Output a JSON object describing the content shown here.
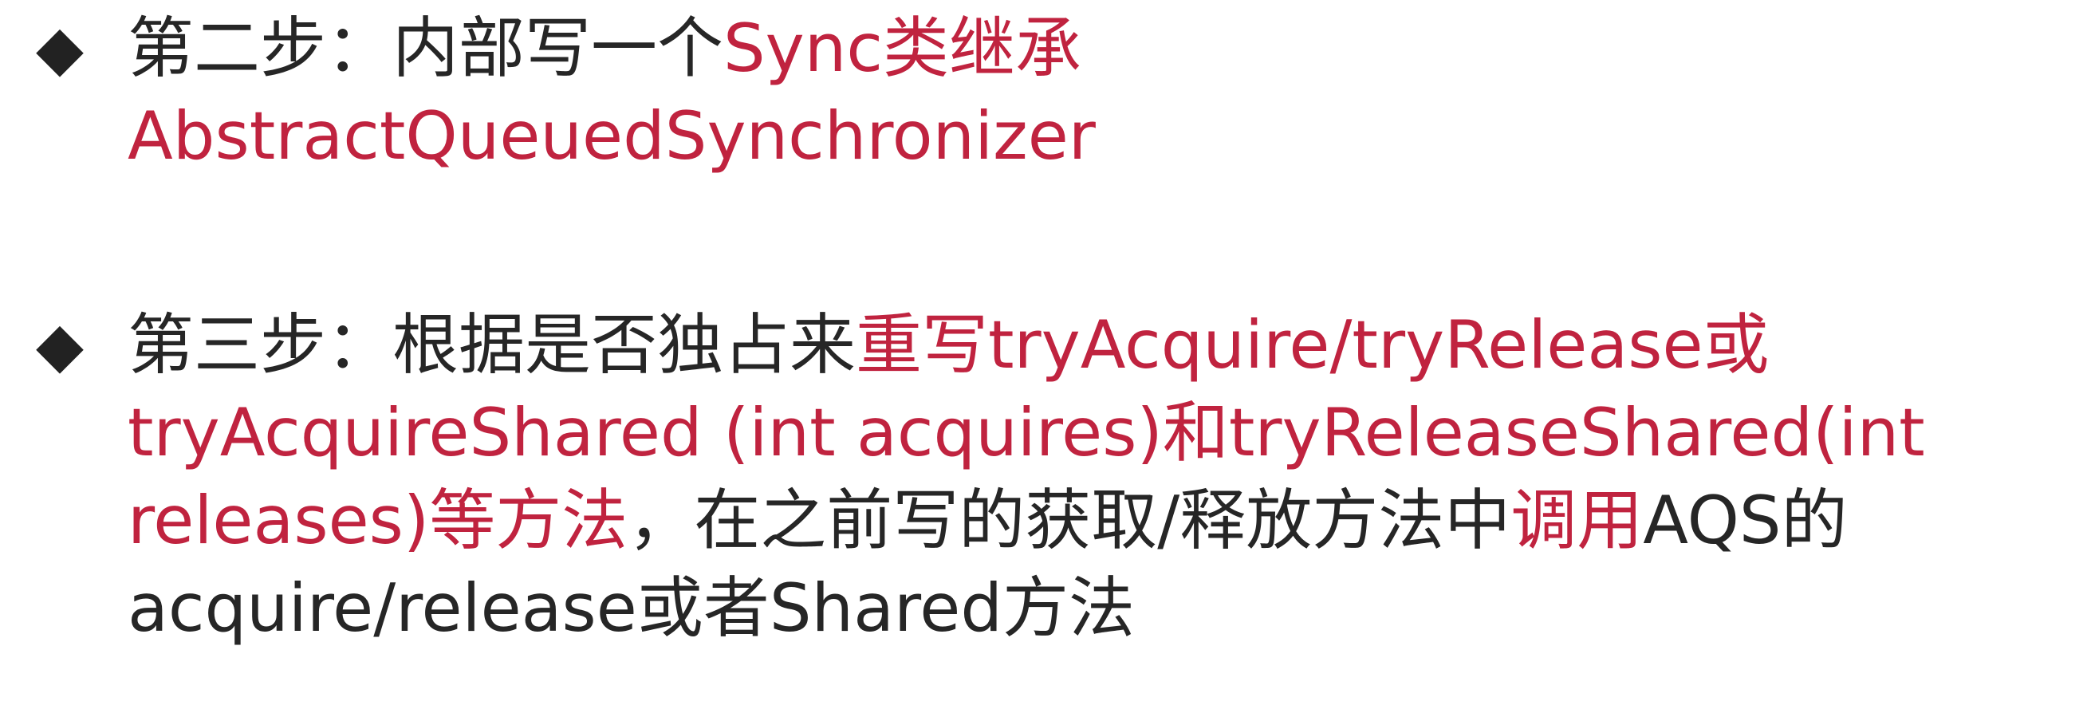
{
  "colors": {
    "accent": "#c0233f",
    "text": "#262626",
    "background": "#ffffff"
  },
  "bullet_icon": "diamond-bullet",
  "step2": {
    "bullet": "◆",
    "lines": [
      [
        {
          "text": "第二步：内部写一个",
          "accent": false
        },
        {
          "text": "Sync类继承",
          "accent": true
        }
      ],
      [
        {
          "text": "AbstractQueuedSynchronizer",
          "accent": true
        }
      ]
    ]
  },
  "step3": {
    "bullet": "◆",
    "lines": [
      [
        {
          "text": "第三步：根据是否独占来",
          "accent": false
        },
        {
          "text": "重写tryAcquire/tryRelease或",
          "accent": true
        }
      ],
      [
        {
          "text": "tryAcquireShared (int acquires)和tryReleaseShared(int",
          "accent": true
        }
      ],
      [
        {
          "text": "releases)等方法",
          "accent": true
        },
        {
          "text": "，在之前写的获取/释放方法中",
          "accent": false
        },
        {
          "text": "调用",
          "accent": true
        },
        {
          "text": "AQS的",
          "accent": false
        }
      ],
      [
        {
          "text": "acquire/release或者Shared方法",
          "accent": false
        }
      ]
    ]
  }
}
